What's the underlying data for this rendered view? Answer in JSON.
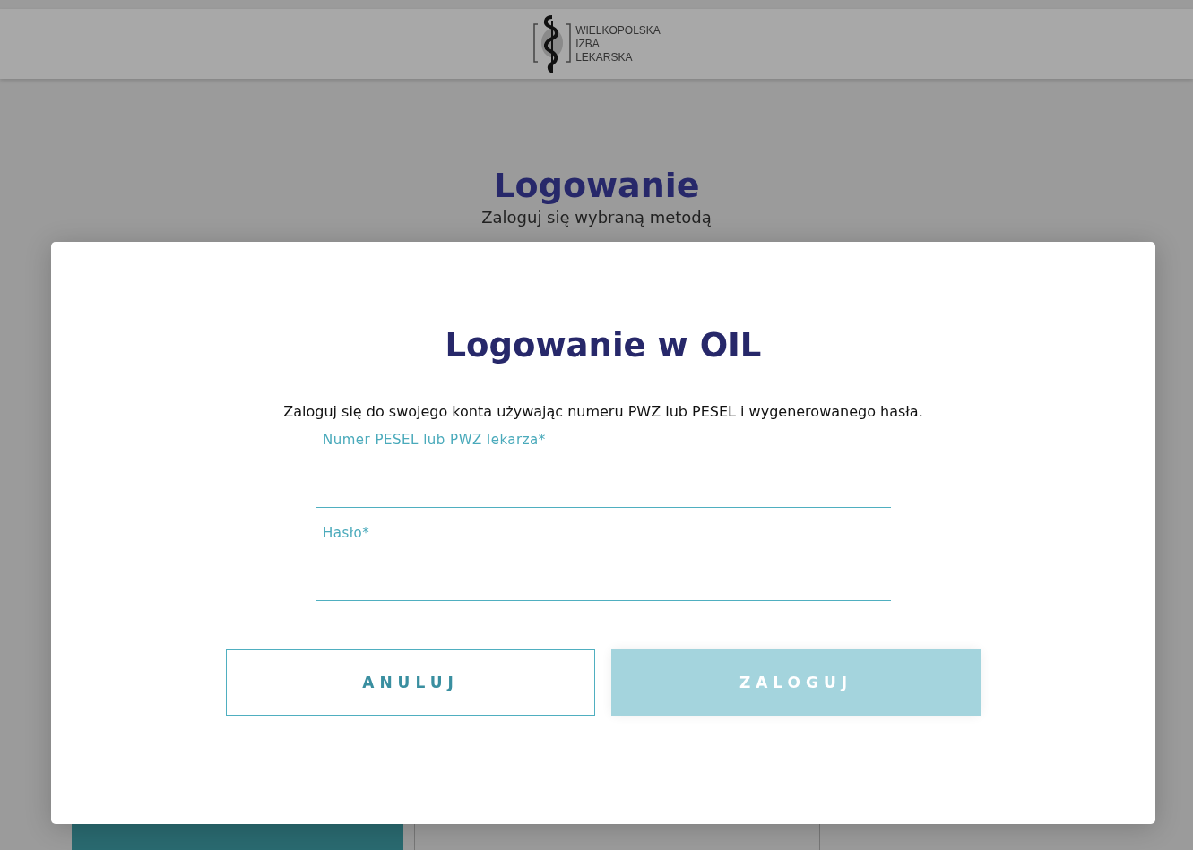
{
  "header": {
    "logo_lines": [
      "WIELKOPOLSKA",
      "IZBA",
      "LEKARSKA"
    ]
  },
  "page": {
    "title": "Logowanie",
    "subtitle": "Zaloguj się wybraną metodą",
    "tiles": [
      {
        "kind": "filled"
      },
      {
        "kind": "outlined"
      },
      {
        "kind": "outlined"
      }
    ]
  },
  "dialog": {
    "title": "Logowanie w OIL",
    "description": "Zaloguj się do swojego konta używając numeru PWZ lub PESEL i wygenerowanego hasła.",
    "fields": [
      {
        "label": "Numer PESEL lub PWZ lekarza*"
      },
      {
        "label": "Hasło*"
      }
    ],
    "buttons": [
      {
        "label": "ANULUJ",
        "kind": "secondary",
        "disabled": false
      },
      {
        "label": "ZALOGUJ",
        "kind": "primary",
        "disabled": true
      }
    ]
  }
}
